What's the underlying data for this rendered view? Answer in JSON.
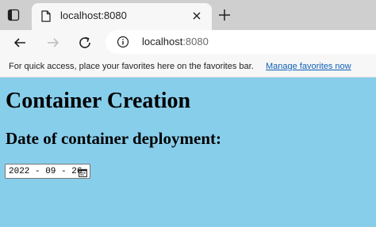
{
  "browser": {
    "tab": {
      "title": "localhost:8080"
    },
    "address": {
      "host": "localhost",
      "port": ":8080"
    },
    "favorites_bar": {
      "message": "For quick access, place your favorites here on the favorites bar.",
      "link": "Manage favorites now"
    }
  },
  "page": {
    "title": "Container Creation",
    "section_title": "Date of container deployment:",
    "date_value": "2022-09-26",
    "background": "#87ceeb"
  }
}
